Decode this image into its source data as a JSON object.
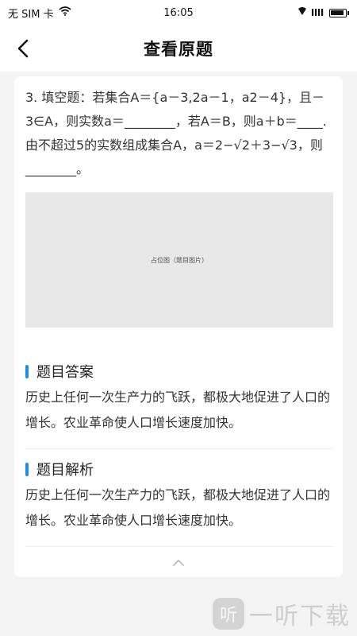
{
  "status_bar": {
    "carrier": "无 SIM 卡",
    "time": "16:05"
  },
  "header": {
    "title": "查看原题"
  },
  "question": {
    "text": "3. 填空题：若集合A＝{a－3,2a－1，a2－4}，且－3∈A，则实数a＝________，若A＝B，则a＋b＝____.由不超过5的实数组成集合A，a＝2−√2＋3−√3，则________。",
    "image_placeholder": "占位图（题目图片）"
  },
  "answer": {
    "title": "题目答案",
    "text": "历史上任何一次生产力的飞跃，都极大地促进了人口的增长。农业革命使人口增长速度加快。"
  },
  "analysis": {
    "title": "题目解析",
    "text": "历史上任何一次生产力的飞跃，都极大地促进了人口的增长。农业革命使人口增长速度加快。"
  },
  "watermark": {
    "logo_glyph": "听",
    "text": "一听下载"
  },
  "colors": {
    "accent": "#1e8ce8",
    "background": "#f4f4f4",
    "card": "#ffffff"
  }
}
